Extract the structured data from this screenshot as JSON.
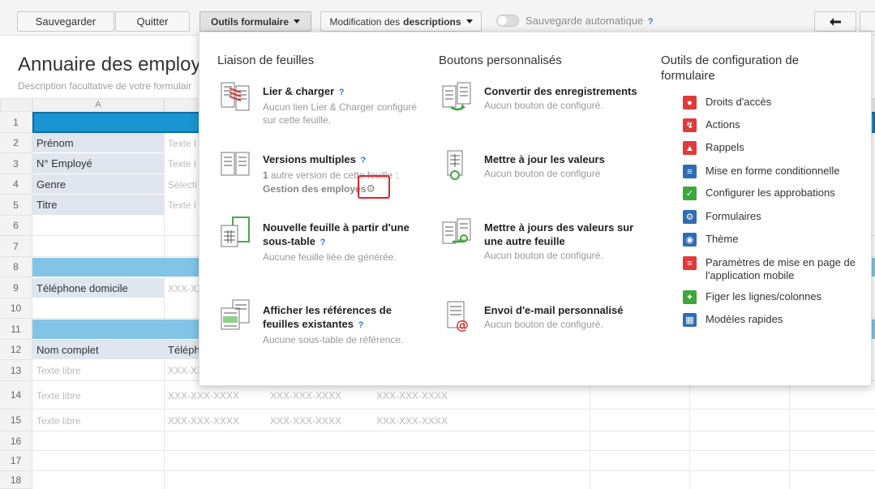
{
  "toolbar": {
    "save": "Sauvegarder",
    "quit": "Quitter",
    "form_tools": "Outils formulaire",
    "edit_prefix": "Modification des",
    "edit_bold": "descriptions",
    "autosave": "Sauvegarde automatique",
    "help": "?",
    "back_icon": "arrow-left-icon"
  },
  "form": {
    "title": "Annuaire des employé",
    "description": "Description facultative de votre formulair"
  },
  "sheet": {
    "column_a": "A",
    "rows": [
      "1",
      "2",
      "3",
      "4",
      "5",
      "6",
      "7",
      "8",
      "9",
      "10",
      "11",
      "12",
      "13",
      "14",
      "15",
      "16",
      "17",
      "18"
    ],
    "labels": {
      "prenom": "Prénom",
      "numero": "N° Employé",
      "genre": "Genre",
      "titre": "Titre",
      "tel_dom": "Téléphone domicile",
      "nom_complet": "Nom complet",
      "telephone": "Téléph"
    },
    "placeholders": {
      "texte_short": "Texte l",
      "selection": "Sélecti",
      "phone_short": "XXX-XX",
      "texte_libre": "Texte libre",
      "phone": "XXX-XXX-XXXX"
    }
  },
  "panel": {
    "col1": {
      "heading": "Liaison de feuilles",
      "items": [
        {
          "title": "Lier & charger",
          "help": "?",
          "sub": "Aucun lien Lier & Charger configuré sur cette feuille."
        },
        {
          "title": "Versions multiples",
          "help": "?",
          "count": "1",
          "sub_rest": " autre version de cette feuille :",
          "sub_link": "Gestion des employés"
        },
        {
          "title": "Nouvelle feuille à partir d'une sous-table",
          "help": "?",
          "sub": "Aucune feuille liée de générée."
        },
        {
          "title": "Afficher les références de feuilles existantes",
          "help": "?",
          "sub": "Aucune sous-table de référence."
        }
      ]
    },
    "col2": {
      "heading": "Boutons personnalisés",
      "items": [
        {
          "title": "Convertir des enregistrements",
          "sub": "Aucun bouton de configuré."
        },
        {
          "title": "Mettre à jour les valeurs",
          "sub": "Aucun bouton de configuré"
        },
        {
          "title": "Mettre à jours des valeurs sur une autre feuille",
          "sub": "Aucun bouton de configuré."
        },
        {
          "title": "Envoi d'e-mail personnalisé",
          "sub": "Aucun bouton de configuré."
        }
      ]
    },
    "col3": {
      "heading": "Outils de configuration de formulaire",
      "items": [
        {
          "label": "Droits d'accès",
          "icon": "users-icon",
          "color": "#e03a3a"
        },
        {
          "label": "Actions",
          "icon": "bolt-icon",
          "color": "#e03a3a"
        },
        {
          "label": "Rappels",
          "icon": "bell-icon",
          "color": "#e03a3a"
        },
        {
          "label": "Mise en forme conditionnelle",
          "icon": "sliders-icon",
          "color": "#2f6db5"
        },
        {
          "label": "Configurer les approbations",
          "icon": "check-square-icon",
          "color": "#3da63d"
        },
        {
          "label": "Formulaires",
          "icon": "gear-icon",
          "color": "#2f6db5"
        },
        {
          "label": "Thème",
          "icon": "palette-icon",
          "color": "#2f6db5"
        },
        {
          "label": "Paramètres de mise en page de l'application mobile",
          "icon": "mobile-layout-icon",
          "color": "#e03a3a"
        },
        {
          "label": "Figer les lignes/colonnes",
          "icon": "pin-icon",
          "color": "#3da63d"
        },
        {
          "label": "Modèles rapides",
          "icon": "calculator-icon",
          "color": "#2f6db5"
        }
      ]
    }
  }
}
